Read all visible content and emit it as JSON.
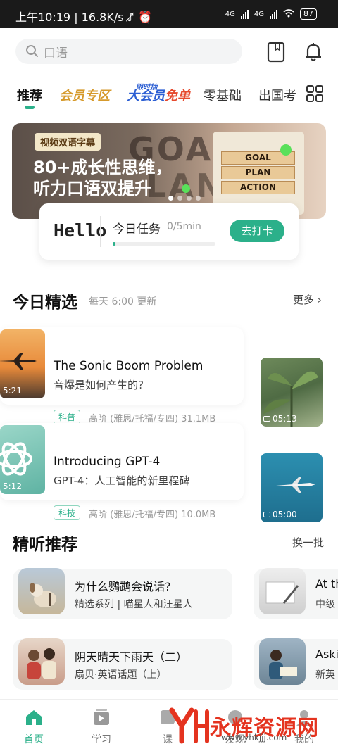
{
  "status_bar": {
    "time": "上午10:19",
    "speed": "16.8K/s",
    "network1": "4G",
    "network2": "4G",
    "battery": "87"
  },
  "header": {
    "search_placeholder": "口语"
  },
  "tabs": [
    {
      "label": "推荐"
    },
    {
      "label": "会员专区"
    },
    {
      "label_main": "大会员",
      "label_free": "免单",
      "badge": "限时抽"
    },
    {
      "label": "零基础"
    },
    {
      "label": "出国考"
    }
  ],
  "banner": {
    "tag": "视频双语字幕",
    "title_line1": "80+成长性思维，",
    "title_line2": "听力口语双提升",
    "bg_word1": "GOAL",
    "bg_word2": "LAN",
    "blocks": [
      "GOAL",
      "PLAN",
      "ACTION"
    ]
  },
  "task": {
    "greeting": "Hello",
    "title": "今日任务",
    "count": "0/5min",
    "progress": 0.03,
    "button": "去打卡"
  },
  "daily": {
    "title": "今日精选",
    "subtitle": "每天 6:00 更新",
    "more": "更多",
    "items": [
      {
        "title_en": "The Sonic Boom Problem",
        "title_cn": "音爆是如何产生的?",
        "category": "科普",
        "meta": "高阶 (雅思/托福/专四)  31.1MB",
        "duration": "5:21",
        "side_duration": "05:13"
      },
      {
        "title_en": "Introducing GPT-4",
        "title_cn": "GPT-4：人工智能的新里程碑",
        "category": "科技",
        "meta": "高阶 (雅思/托福/专四)  10.0MB",
        "duration": "5:12",
        "side_duration": "05:00"
      }
    ]
  },
  "listening": {
    "title": "精听推荐",
    "refresh": "换一批",
    "items": [
      {
        "title": "为什么鹦鹉会说话?",
        "subtitle": "精选系列 | 喵星人和汪星人"
      },
      {
        "title": "At th",
        "subtitle": "中级"
      },
      {
        "title": "阴天晴天下雨天（二）",
        "subtitle": "扇贝·英语话题（上）"
      },
      {
        "title": "Aski",
        "subtitle": "新英"
      }
    ]
  },
  "bottom_nav": [
    {
      "label": "首页",
      "icon": "home-icon"
    },
    {
      "label": "学习",
      "icon": "play-book-icon"
    },
    {
      "label": "课",
      "icon": "course-icon"
    },
    {
      "label": "发现",
      "icon": "discover-icon"
    },
    {
      "label": "我的",
      "icon": "profile-icon"
    }
  ],
  "watermark": {
    "text": "永辉资源网",
    "url": "www.yhkjjj.com"
  },
  "colors": {
    "accent": "#2bb08a",
    "vip_gold": "#d69a2c",
    "vip_blue": "#2d5fd3",
    "watermark_red": "#e4331f"
  }
}
